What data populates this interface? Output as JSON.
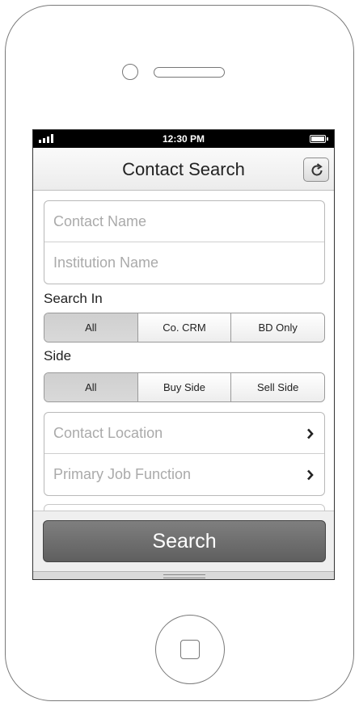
{
  "status_bar": {
    "time": "12:30 PM",
    "signal_icon": "signal-bars-icon",
    "battery_icon": "battery-icon"
  },
  "nav": {
    "title": "Contact Search",
    "refresh_icon": "refresh-icon"
  },
  "fields": {
    "contact_name": {
      "placeholder": "Contact Name",
      "value": ""
    },
    "institution_name": {
      "placeholder": "Institution Name",
      "value": ""
    }
  },
  "search_in": {
    "label": "Search In",
    "options": [
      "All",
      "Co. CRM",
      "BD Only"
    ],
    "selected": "All"
  },
  "side": {
    "label": "Side",
    "options": [
      "All",
      "Buy Side",
      "Sell Side"
    ],
    "selected": "All"
  },
  "pickers": {
    "contact_location": "Contact Location",
    "primary_job_function": "Primary Job Function",
    "chevron_icon": "chevron-right-icon"
  },
  "actions": {
    "search_label": "Search"
  }
}
